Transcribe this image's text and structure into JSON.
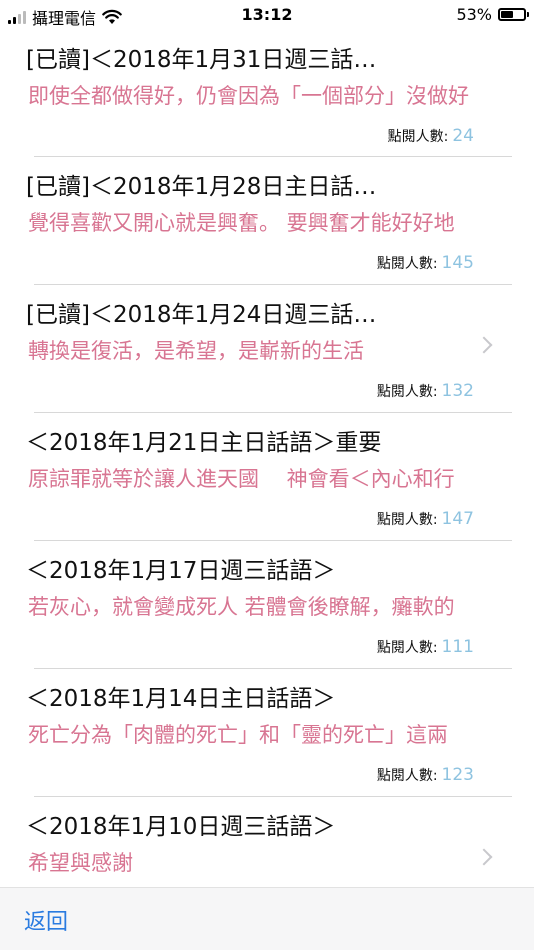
{
  "status_bar": {
    "carrier": "攝理電信",
    "time": "13:12",
    "battery": "53%",
    "battery_level": 0.53
  },
  "list": {
    "meta_label": "點閱人數:",
    "items": [
      {
        "title": "[已讀]＜2018年1月31日週三話…",
        "subtitle": "即使全都做得好，仍會因為「一個部分」沒做好",
        "count": "24",
        "chevron": false
      },
      {
        "title": "[已讀]＜2018年1月28日主日話…",
        "subtitle": "覺得喜歡又開心就是興奮。 要興奮才能好好地",
        "count": "145",
        "chevron": false
      },
      {
        "title": "[已讀]＜2018年1月24日週三話…",
        "subtitle": "轉換是復活，是希望，是嶄新的生活",
        "count": "132",
        "chevron": true
      },
      {
        "title": "＜2018年1月21日主日話語＞重要",
        "subtitle": "原諒罪就等於讓人進天國　 神會看＜內心和行",
        "count": "147",
        "chevron": false
      },
      {
        "title": "＜2018年1月17日週三話語＞",
        "subtitle": "若灰心，就會變成死人 若體會後瞭解，癱軟的",
        "count": "111",
        "chevron": false
      },
      {
        "title": "＜2018年1月14日主日話語＞",
        "subtitle": "死亡分為「肉體的死亡」和「靈的死亡」這兩",
        "count": "123",
        "chevron": false
      },
      {
        "title": "＜2018年1月10日週三話語＞",
        "subtitle": "希望與感謝",
        "count": "",
        "chevron": true
      }
    ]
  },
  "toolbar": {
    "back_label": "返回"
  },
  "colors": {
    "subtitle": "#d87592",
    "count": "#8ec3e0",
    "link": "#2a7be0"
  }
}
